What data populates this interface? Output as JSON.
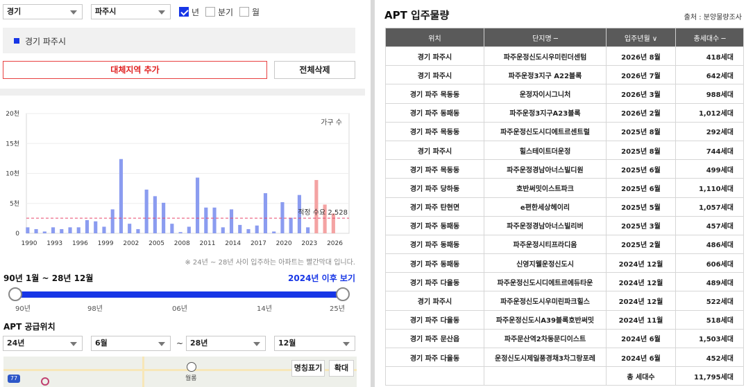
{
  "filters": {
    "province": "경기",
    "city": "파주시",
    "period_options": [
      {
        "label": "년",
        "checked": true
      },
      {
        "label": "분기",
        "checked": false
      },
      {
        "label": "월",
        "checked": false
      }
    ]
  },
  "region_list": [
    "경기 파주시"
  ],
  "buttons": {
    "add_region": "대체지역 추가",
    "delete_all": "전체삭제"
  },
  "chart_data": {
    "type": "bar",
    "title": "",
    "legend": "가구 수",
    "ylim": [
      0,
      20000
    ],
    "y_ticks": [
      "0",
      "5천",
      "10천",
      "15천",
      "20천"
    ],
    "x_ticks": [
      "1990",
      "1993",
      "1996",
      "1999",
      "2002",
      "2005",
      "2008",
      "2011",
      "2014",
      "2017",
      "2020",
      "2023",
      "2026"
    ],
    "x_start": 1990,
    "x_end": 2028,
    "highlight_from": 2024,
    "values": [
      1000,
      700,
      300,
      1000,
      700,
      1000,
      1000,
      2200,
      2000,
      1100,
      4000,
      12400,
      1600,
      700,
      7300,
      6200,
      5100,
      1600,
      200,
      1100,
      9300,
      4300,
      4300,
      1000,
      4000,
      1400,
      700,
      1300,
      6700,
      300,
      5200,
      2600,
      6400,
      1000,
      8900,
      4800,
      3300
    ],
    "reference_line": {
      "label": "적정 수요 2,528",
      "value": 2528,
      "color": "#e8456b"
    },
    "colors": {
      "normal": "#8b9cf0",
      "highlight": "#f4a3a3"
    }
  },
  "chart_note": "※ 24년 ~ 28년 사이 입주하는 아파트는 빨간막대 입니다.",
  "range": {
    "title": "90년 1월 ~ 28년 12월",
    "link": "2024년 이후 보기",
    "ticks": [
      "90년",
      "98년",
      "06년",
      "14년",
      "25년"
    ]
  },
  "supply": {
    "title": "APT 공급위치",
    "from_year": "24년",
    "from_month": "6월",
    "tilde": "~",
    "to_year": "28년",
    "to_month": "12월"
  },
  "map": {
    "place": "월롱",
    "badge": "77",
    "btn_label": "명칭표기",
    "btn_zoom": "확대"
  },
  "apt": {
    "title": "APT 입주물량",
    "source": "출처 : 분양물량조사",
    "headers": [
      "위치",
      "단지명 ─",
      "입주년월 ∨",
      "총세대수 ─"
    ],
    "rows": [
      [
        "경기 파주시",
        "파주운정신도시우미린더센텀",
        "2026년 8월",
        "418세대"
      ],
      [
        "경기 파주시",
        "파주운정3지구 A22블록",
        "2026년 7월",
        "642세대"
      ],
      [
        "경기 파주 목동동",
        "운정자이시그니처",
        "2026년 3월",
        "988세대"
      ],
      [
        "경기 파주 동패동",
        "파주운정3지구A23블록",
        "2026년 2월",
        "1,012세대"
      ],
      [
        "경기 파주 목동동",
        "파주운정신도시디에트르센트럴",
        "2025년 8월",
        "292세대"
      ],
      [
        "경기 파주시",
        "힐스테이트더운정",
        "2025년 8월",
        "744세대"
      ],
      [
        "경기 파주 목동동",
        "파주운정경남아너스빌디원",
        "2025년 6월",
        "499세대"
      ],
      [
        "경기 파주 당하동",
        "호반써밋이스트파크",
        "2025년 6월",
        "1,110세대"
      ],
      [
        "경기 파주 탄현면",
        "e편한세상헤이리",
        "2025년 5월",
        "1,057세대"
      ],
      [
        "경기 파주 동패동",
        "파주운정경남아너스빌리버",
        "2025년 3월",
        "457세대"
      ],
      [
        "경기 파주 동패동",
        "파주운정시티프라디움",
        "2025년 2월",
        "486세대"
      ],
      [
        "경기 파주 동패동",
        "신영지웰운정신도시",
        "2024년 12월",
        "606세대"
      ],
      [
        "경기 파주 다율동",
        "파주운정신도시디에트르에듀타운",
        "2024년 12월",
        "489세대"
      ],
      [
        "경기 파주시",
        "파주운정신도시우미린파크힐스",
        "2024년 12월",
        "522세대"
      ],
      [
        "경기 파주 다율동",
        "파주운정신도시A39블록호반써밋",
        "2024년 11월",
        "518세대"
      ],
      [
        "경기 파주 문산읍",
        "파주문산역2차동문디이스트",
        "2024년 6월",
        "1,503세대"
      ],
      [
        "경기 파주 다율동",
        "운정신도시제일풍경채3차그랑포레",
        "2024년 6월",
        "452세대"
      ]
    ],
    "total_label": "총 세대수",
    "total_value": "11,795세대"
  }
}
